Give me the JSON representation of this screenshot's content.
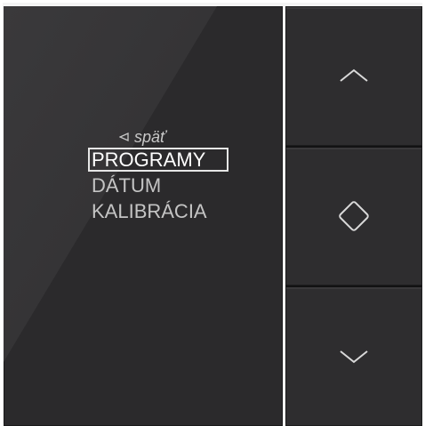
{
  "menu": {
    "back_label": "späť",
    "items": [
      {
        "label": "PROGRAMY",
        "selected": true
      },
      {
        "label": "DÁTUM",
        "selected": false
      },
      {
        "label": "KALIBRÁCIA",
        "selected": false
      }
    ]
  },
  "buttons": [
    {
      "icon": "chevron-up-icon"
    },
    {
      "icon": "diamond-ok-icon"
    },
    {
      "icon": "chevron-down-icon"
    }
  ],
  "colors": {
    "panel": "#2b2a2c",
    "text": "#c4c4c4",
    "selected_text": "#ffffff",
    "icon": "#d9d9d9"
  }
}
